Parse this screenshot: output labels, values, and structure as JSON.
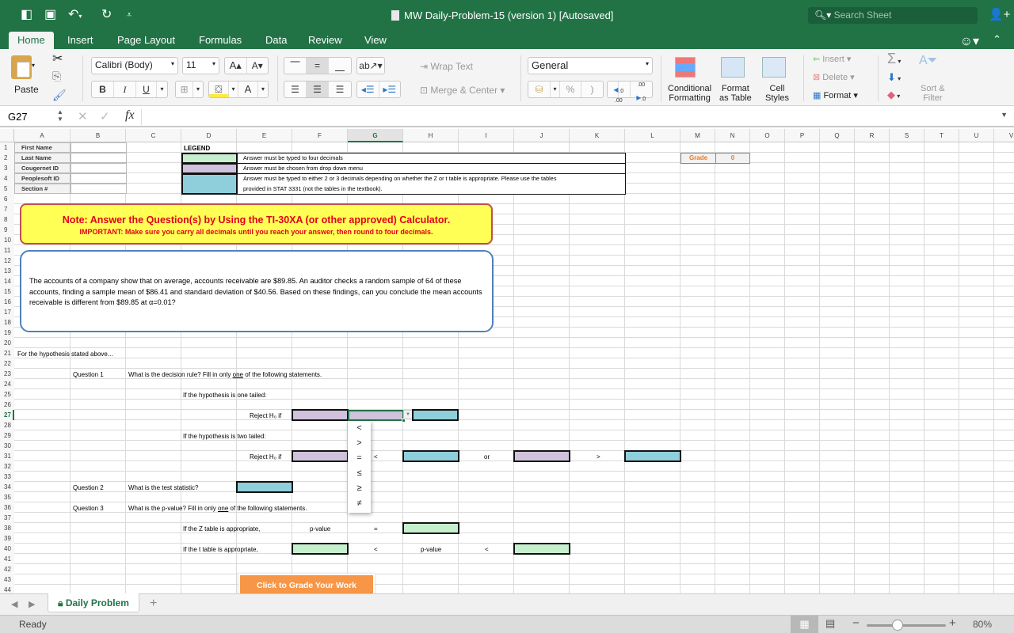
{
  "window": {
    "title": "MW Daily-Problem-15 (version 1) [Autosaved]",
    "search_placeholder": "Search Sheet",
    "qat": {
      "sidebar_icon": "sidebar-icon",
      "save_icon": "save-icon",
      "undo_icon": "undo-icon",
      "redo_icon": "redo-icon",
      "customize_icon": "customize-icon"
    }
  },
  "ribbon": {
    "tabs": [
      "Home",
      "Insert",
      "Page Layout",
      "Formulas",
      "Data",
      "Review",
      "View"
    ],
    "active_tab": "Home",
    "clipboard": {
      "paste": "Paste"
    },
    "font": {
      "name": "Calibri (Body)",
      "size": "11",
      "bold": "B",
      "italic": "I",
      "underline": "U",
      "grow": "A▴",
      "shrink": "A▾",
      "color_glyph": "A"
    },
    "alignment": {
      "wrap_text": "Wrap Text",
      "merge_center": "Merge & Center"
    },
    "number": {
      "format": "General",
      "percent": "%",
      "comma": ")",
      "inc_dec": "←.0 .00",
      "dec_dec": ".00 →.0"
    },
    "styles": {
      "conditional_formatting": [
        "Conditional",
        "Formatting"
      ],
      "format_as_table": [
        "Format",
        "as Table"
      ],
      "cell_styles": [
        "Cell",
        "Styles"
      ]
    },
    "cells": {
      "insert": "Insert",
      "delete": "Delete",
      "format": "Format"
    },
    "editing": {
      "autosum": "Σ",
      "sort_filter": [
        "Sort &",
        "Filter"
      ]
    }
  },
  "formula_bar": {
    "name_box": "G27",
    "fx": "fx",
    "value": ""
  },
  "columns": [
    "A",
    "B",
    "C",
    "D",
    "E",
    "F",
    "G",
    "H",
    "I",
    "J",
    "K",
    "L",
    "M",
    "N",
    "O",
    "P",
    "Q",
    "R",
    "S",
    "T",
    "U",
    "V"
  ],
  "selected_column": "G",
  "selected_row": 27,
  "rows": [
    "1",
    "2",
    "3",
    "4",
    "5",
    "6",
    "7",
    "8",
    "9",
    "10",
    "11",
    "12",
    "13",
    "14",
    "15",
    "16",
    "17",
    "18",
    "19",
    "20",
    "21",
    "22",
    "23",
    "24",
    "25",
    "26",
    "27",
    "28",
    "29",
    "30",
    "31",
    "32",
    "33",
    "34",
    "35",
    "36",
    "37",
    "38",
    "39",
    "40",
    "41",
    "42",
    "43",
    "44"
  ],
  "sheet": {
    "student_labels": [
      "First Name",
      "Last Name",
      "Cougernet ID",
      "Peoplesoft ID",
      "Section #"
    ],
    "legend": {
      "title": "LEGEND",
      "items": [
        {
          "color": "#c6efce",
          "text": "Answer must be typed to four decimals"
        },
        {
          "color": "#d0c2dc",
          "text": "Answer must be chosen from drop down menu"
        },
        {
          "color": "#8ecfdb",
          "text": "Answer must be typed to either 2 or 3 decimals depending on whether the Z or t table is appropriate.  Please use the tables",
          "text2": "provided in STAT 3331 (not the tables in the textbook)."
        }
      ]
    },
    "grade": {
      "label": "Grade",
      "value": "0"
    },
    "note": {
      "line1": "Note: Answer the Question(s) by Using the TI-30XA (or other approved) Calculator.",
      "line2": "IMPORTANT: Make sure you carry all decimals until you reach your answer, then round to four decimals."
    },
    "problem": "The accounts of a company show that on average, accounts receivable are $89.85.  An auditor checks a random sample of 64 of these accounts, finding a sample mean of $86.41 and standard deviation of $40.56.  Based on these findings, can you conclude the mean accounts receivable is different from $89.85 at α=0.01?",
    "intro": "For the hypothesis stated above...",
    "q1": {
      "label": "Question 1",
      "text_pre": "What is the decision rule?   Fill in only ",
      "text_em": "one",
      "text_post": " of the following statements.",
      "one_tailed": "If the hypothesis is one tailed:",
      "two_tailed": "If the hypothesis is two tailed:",
      "reject": "Reject H₀ if",
      "lt": "<",
      "or": "or",
      "gt": ">"
    },
    "q2": {
      "label": "Question 2",
      "text": "What is the test statistic?"
    },
    "q3": {
      "label": "Question 3",
      "text_pre": "What is the p-value?  Fill in only ",
      "text_em": "one",
      "text_post": " of the following statements.",
      "z_label": "If the Z table is appropriate,",
      "t_label": "If the t table is appropriate,",
      "pvalue": "p-value",
      "eq": "=",
      "lt": "<"
    },
    "grade_button": "Click to Grade Your Work",
    "dropdown_options": [
      "<",
      ">",
      "=",
      "≤",
      "≥",
      "≠"
    ]
  },
  "sheet_tabs": {
    "active": "Daily Problem",
    "add": "+"
  },
  "status": {
    "text": "Ready",
    "zoom": "80%",
    "zoom_fraction": 0.5
  }
}
